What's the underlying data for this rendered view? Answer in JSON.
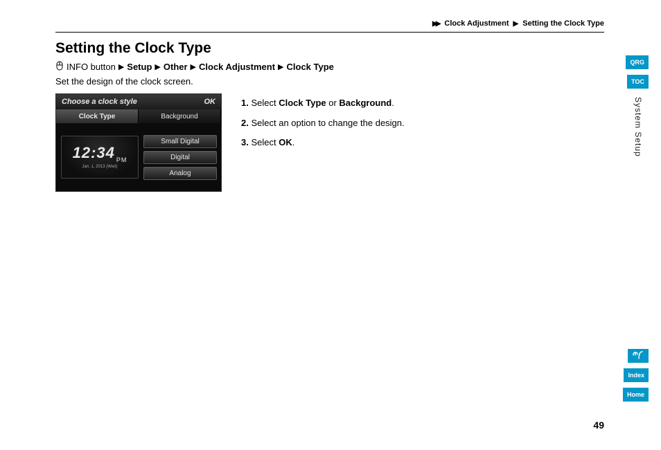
{
  "breadcrumb": {
    "item1": "Clock Adjustment",
    "item2": "Setting the Clock Type"
  },
  "title": "Setting the Clock Type",
  "navpath": {
    "info_button": "INFO button",
    "setup": "Setup",
    "other": "Other",
    "clock_adjustment": "Clock Adjustment",
    "clock_type": "Clock Type"
  },
  "lead": "Set the design of the clock screen.",
  "screenshot": {
    "header_title": "Choose a clock style",
    "header_ok": "OK",
    "tab_clock_type": "Clock Type",
    "tab_background": "Background",
    "clock_time": "12:34",
    "clock_ampm": "PM",
    "clock_date": "Jan. 1, 2013 (Wed)",
    "opt_small_digital": "Small Digital",
    "opt_digital": "Digital",
    "opt_analog": "Analog"
  },
  "steps": {
    "s1_num": "1.",
    "s1_a": "Select ",
    "s1_b1": "Clock Type",
    "s1_mid": " or ",
    "s1_b2": "Background",
    "s1_end": ".",
    "s2_num": "2.",
    "s2_text": "Select an option to change the design.",
    "s3_num": "3.",
    "s3_a": "Select ",
    "s3_b": "OK",
    "s3_end": "."
  },
  "sidenav": {
    "qrg": "QRG",
    "toc": "TOC",
    "section": "System Setup",
    "voice_icon": "ᵐʃ",
    "index": "Index",
    "home": "Home"
  },
  "page_number": "49"
}
